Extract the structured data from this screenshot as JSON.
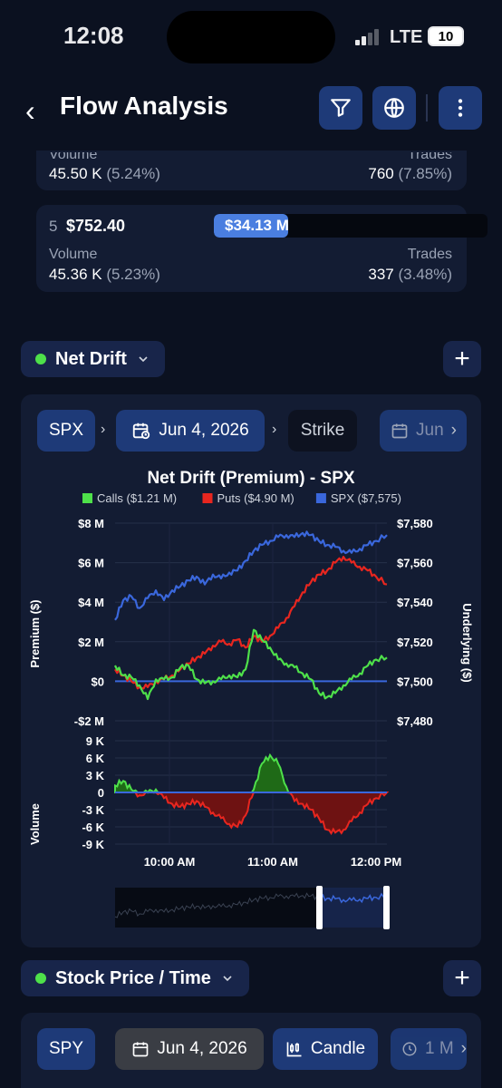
{
  "status": {
    "time": "12:08",
    "network": "LTE",
    "battery": "10"
  },
  "header": {
    "title": "Flow Analysis",
    "back_icon": "chevron-left-icon"
  },
  "rows": [
    {
      "volume_label": "Volume",
      "volume": "45.50 K",
      "volume_pct": "(5.24%)",
      "trades_label": "Trades",
      "trades": "760",
      "trades_pct": "(7.85%)"
    },
    {
      "rank": "5",
      "price": "$752.40",
      "premium": "$34.13 M",
      "premium_fill": 0.27,
      "volume_label": "Volume",
      "volume": "45.36 K",
      "volume_pct": "(5.23%)",
      "trades_label": "Trades",
      "trades": "337",
      "trades_pct": "(3.48%)"
    }
  ],
  "net_drift": {
    "section_label": "Net Drift",
    "chips": {
      "symbol": "SPX",
      "date": "Jun 4, 2026",
      "strike": "Strike",
      "date2": "Jun"
    }
  },
  "chart_data": {
    "type": "line",
    "title": "Net Drift (Premium) - SPX",
    "legend": [
      {
        "name": "Calls ($1.21 M)",
        "color": "#4ee04a"
      },
      {
        "name": "Puts ($4.90 M)",
        "color": "#e8261f"
      },
      {
        "name": "SPX ($7,575)",
        "color": "#3a67dc"
      }
    ],
    "ylabel_left": "Premium ($)",
    "ylabel_right": "Underlying ($)",
    "ylabel_volume": "Volume",
    "y_left_ticks": [
      "$8 M",
      "$6 M",
      "$4 M",
      "$2 M",
      "$0",
      "-$2 M"
    ],
    "y_right_ticks": [
      "$7,580",
      "$7,560",
      "$7,540",
      "$7,520",
      "$7,500",
      "$7,480"
    ],
    "volume_ticks": [
      "9 K",
      "6 K",
      "3 K",
      "0",
      "-3 K",
      "-6 K",
      "-9 K"
    ],
    "x_ticks": [
      "10:00 AM",
      "11:00 AM",
      "12:00 PM"
    ],
    "ylim_left": [
      -2,
      8
    ],
    "ylim_right": [
      7480,
      7580
    ],
    "ylim_volume": [
      -9,
      9
    ],
    "x_range": [
      0,
      100
    ],
    "series": [
      {
        "name": "SPX",
        "axis": "right",
        "x": [
          0,
          3,
          6,
          9,
          12,
          15,
          18,
          21,
          24,
          27,
          30,
          33,
          36,
          39,
          42,
          45,
          48,
          51,
          54,
          57,
          60,
          63,
          66,
          69,
          72,
          75,
          78,
          81,
          84,
          87,
          90,
          93,
          96,
          100
        ],
        "values": [
          7531,
          7541,
          7543,
          7537,
          7542,
          7546,
          7541,
          7546,
          7548,
          7551,
          7553,
          7549,
          7554,
          7552,
          7555,
          7556,
          7561,
          7566,
          7569,
          7571,
          7573,
          7574,
          7573,
          7575,
          7574,
          7571,
          7569,
          7568,
          7566,
          7565,
          7567,
          7569,
          7571,
          7574
        ]
      },
      {
        "name": "Calls",
        "axis": "left",
        "x": [
          0,
          3,
          6,
          9,
          12,
          15,
          18,
          21,
          24,
          27,
          30,
          33,
          36,
          39,
          42,
          45,
          48,
          51,
          54,
          57,
          60,
          63,
          66,
          69,
          72,
          75,
          78,
          81,
          84,
          87,
          90,
          93,
          96,
          100
        ],
        "values": [
          0.8,
          0.3,
          0.2,
          -0.2,
          -0.9,
          0.1,
          0.1,
          0.2,
          0.7,
          0.8,
          0.1,
          -0.1,
          0.0,
          0.1,
          0.3,
          0.2,
          0.6,
          2.6,
          2.1,
          1.7,
          1.1,
          0.9,
          0.7,
          0.4,
          0.1,
          -0.6,
          -0.8,
          -0.6,
          -0.2,
          0.1,
          0.4,
          0.8,
          1.1,
          1.2
        ]
      },
      {
        "name": "Puts",
        "axis": "left",
        "x": [
          0,
          3,
          6,
          9,
          12,
          15,
          18,
          21,
          24,
          27,
          30,
          33,
          36,
          39,
          42,
          45,
          48,
          51,
          54,
          57,
          60,
          63,
          66,
          69,
          72,
          75,
          78,
          81,
          84,
          87,
          90,
          93,
          96,
          100
        ],
        "values": [
          0.6,
          0.3,
          0.0,
          -0.3,
          -0.3,
          0.0,
          0.1,
          0.3,
          0.6,
          0.9,
          1.2,
          1.4,
          1.8,
          2.0,
          1.9,
          2.1,
          1.7,
          2.3,
          2.0,
          2.3,
          2.7,
          3.2,
          3.8,
          4.5,
          5.0,
          5.4,
          5.6,
          6.0,
          6.3,
          6.0,
          5.8,
          5.6,
          5.3,
          4.9
        ]
      },
      {
        "name": "Volume",
        "axis": "volume",
        "x": [
          0,
          3,
          6,
          9,
          12,
          15,
          18,
          21,
          24,
          27,
          30,
          33,
          36,
          39,
          42,
          45,
          48,
          51,
          54,
          57,
          60,
          63,
          66,
          69,
          72,
          75,
          78,
          81,
          84,
          87,
          90,
          93,
          96,
          100
        ],
        "values": [
          1.2,
          2.0,
          0.5,
          -0.5,
          0.0,
          0.5,
          -1.0,
          -2.0,
          -2.5,
          -2.0,
          -1.5,
          -2.5,
          -3.5,
          -4.5,
          -5.5,
          -6.0,
          -4.0,
          0.5,
          5.0,
          6.5,
          5.0,
          1.0,
          -1.5,
          -2.0,
          -3.0,
          -4.5,
          -6.5,
          -7.0,
          -6.5,
          -5.0,
          -3.5,
          -2.0,
          -1.0,
          0.0
        ]
      }
    ],
    "minimap_window": [
      0.75,
      1.0
    ]
  },
  "stock_section": {
    "section_label": "Stock Price / Time",
    "chips": {
      "symbol": "SPY",
      "date": "Jun 4, 2026",
      "chart_type": "Candle",
      "interval": "1 M"
    }
  }
}
